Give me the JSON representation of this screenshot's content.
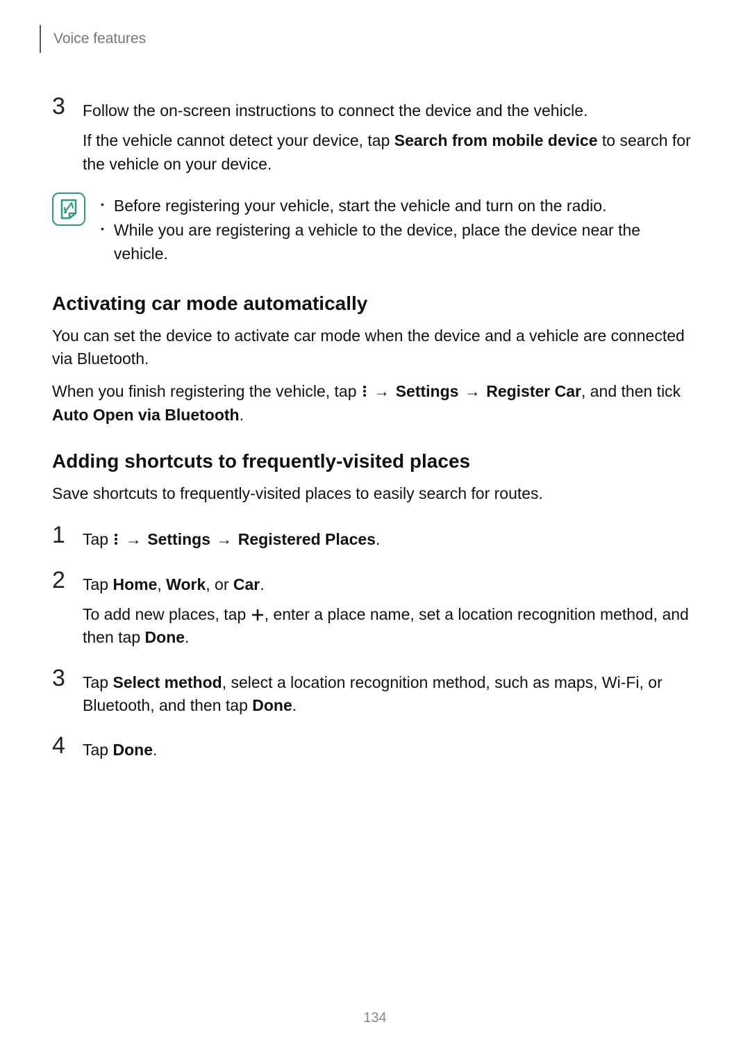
{
  "header": {
    "title": "Voice features"
  },
  "step3a": {
    "num": "3",
    "line1": "Follow the on-screen instructions to connect the device and the vehicle.",
    "line2a": "If the vehicle cannot detect your device, tap ",
    "line2b": "Search from mobile device",
    "line2c": " to search for the vehicle on your device."
  },
  "note": {
    "items": [
      "Before registering your vehicle, start the vehicle and turn on the radio.",
      "While you are registering a vehicle to the device, place the device near the vehicle."
    ]
  },
  "section1": {
    "heading": "Activating car mode automatically",
    "p1": "You can set the device to activate car mode when the device and a vehicle are connected via Bluetooth.",
    "p2a": "When you finish registering the vehicle, tap ",
    "arrow": "→",
    "settings": "Settings",
    "registerCar": "Register Car",
    "p2b": ", and then tick ",
    "auto": "Auto Open via Bluetooth",
    "period": "."
  },
  "section2": {
    "heading": "Adding shortcuts to frequently-visited places",
    "p1": "Save shortcuts to frequently-visited places to easily search for routes."
  },
  "s2step1": {
    "num": "1",
    "tap": "Tap ",
    "arrow": "→",
    "settings": "Settings",
    "regPlaces": "Registered Places",
    "period": "."
  },
  "s2step2": {
    "num": "2",
    "tap": "Tap ",
    "home": "Home",
    "comma1": ", ",
    "work": "Work",
    "comma2": ", or ",
    "car": "Car",
    "period": ".",
    "line2a": "To add new places, tap ",
    "line2b": ", enter a place name, set a location recognition method, and then tap ",
    "done": "Done",
    "period2": "."
  },
  "s2step3": {
    "num": "3",
    "tap": "Tap ",
    "selectMethod": "Select method",
    "mid": ", select a location recognition method, such as maps, Wi-Fi, or Bluetooth, and then tap ",
    "done": "Done",
    "period": "."
  },
  "s2step4": {
    "num": "4",
    "tap": "Tap ",
    "done": "Done",
    "period": "."
  },
  "pageNumber": "134"
}
